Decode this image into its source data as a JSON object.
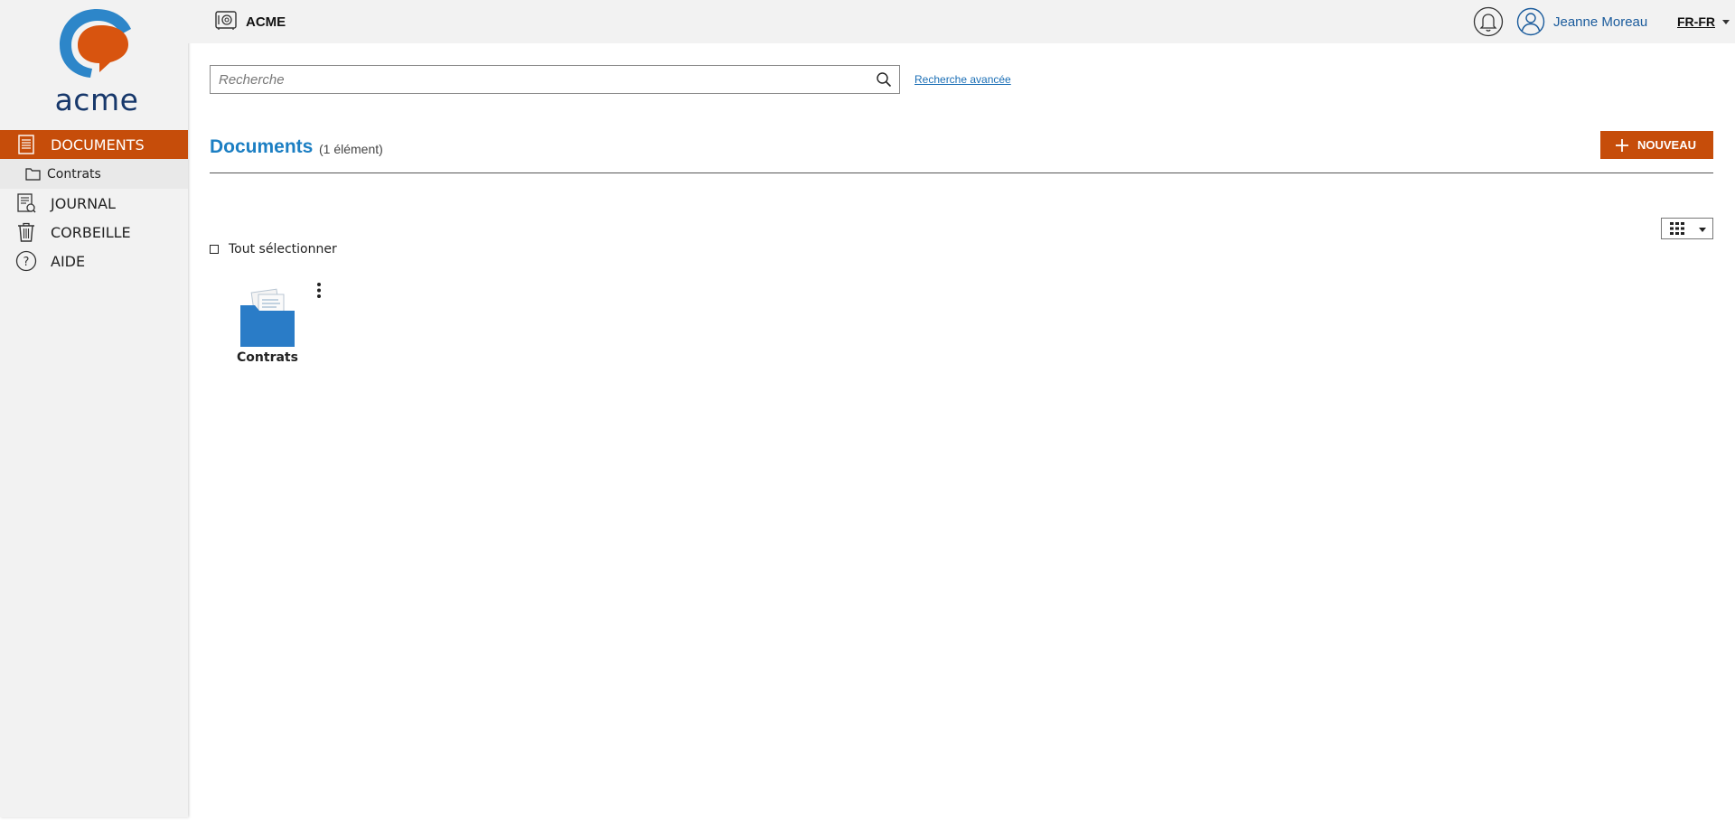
{
  "app": {
    "logo_text": "acme",
    "brand": "ACME"
  },
  "sidebar": {
    "items": [
      {
        "label": "DOCUMENTS",
        "icon": "document-icon",
        "active": true
      },
      {
        "label": "Contrats",
        "icon": "folder-icon",
        "sub": true
      },
      {
        "label": "JOURNAL",
        "icon": "journal-icon"
      },
      {
        "label": "CORBEILLE",
        "icon": "trash-icon"
      },
      {
        "label": "AIDE",
        "icon": "help-icon"
      }
    ]
  },
  "header": {
    "user_name": "Jeanne Moreau",
    "language": "FR-FR",
    "notifications_icon": "bell-icon",
    "user_icon": "user-icon"
  },
  "search": {
    "placeholder": "Recherche",
    "advanced_link": "Recherche avancée"
  },
  "main": {
    "title": "Documents",
    "count": "(1 élément)",
    "new_button": "NOUVEAU",
    "select_all": "Tout sélectionner",
    "items": [
      {
        "name": "Contrats",
        "type": "folder"
      }
    ]
  },
  "colors": {
    "accent": "#c64d0a",
    "title_blue": "#1c7fc3",
    "folder_blue": "#2a7cc7",
    "logo_navy": "#17386b"
  }
}
